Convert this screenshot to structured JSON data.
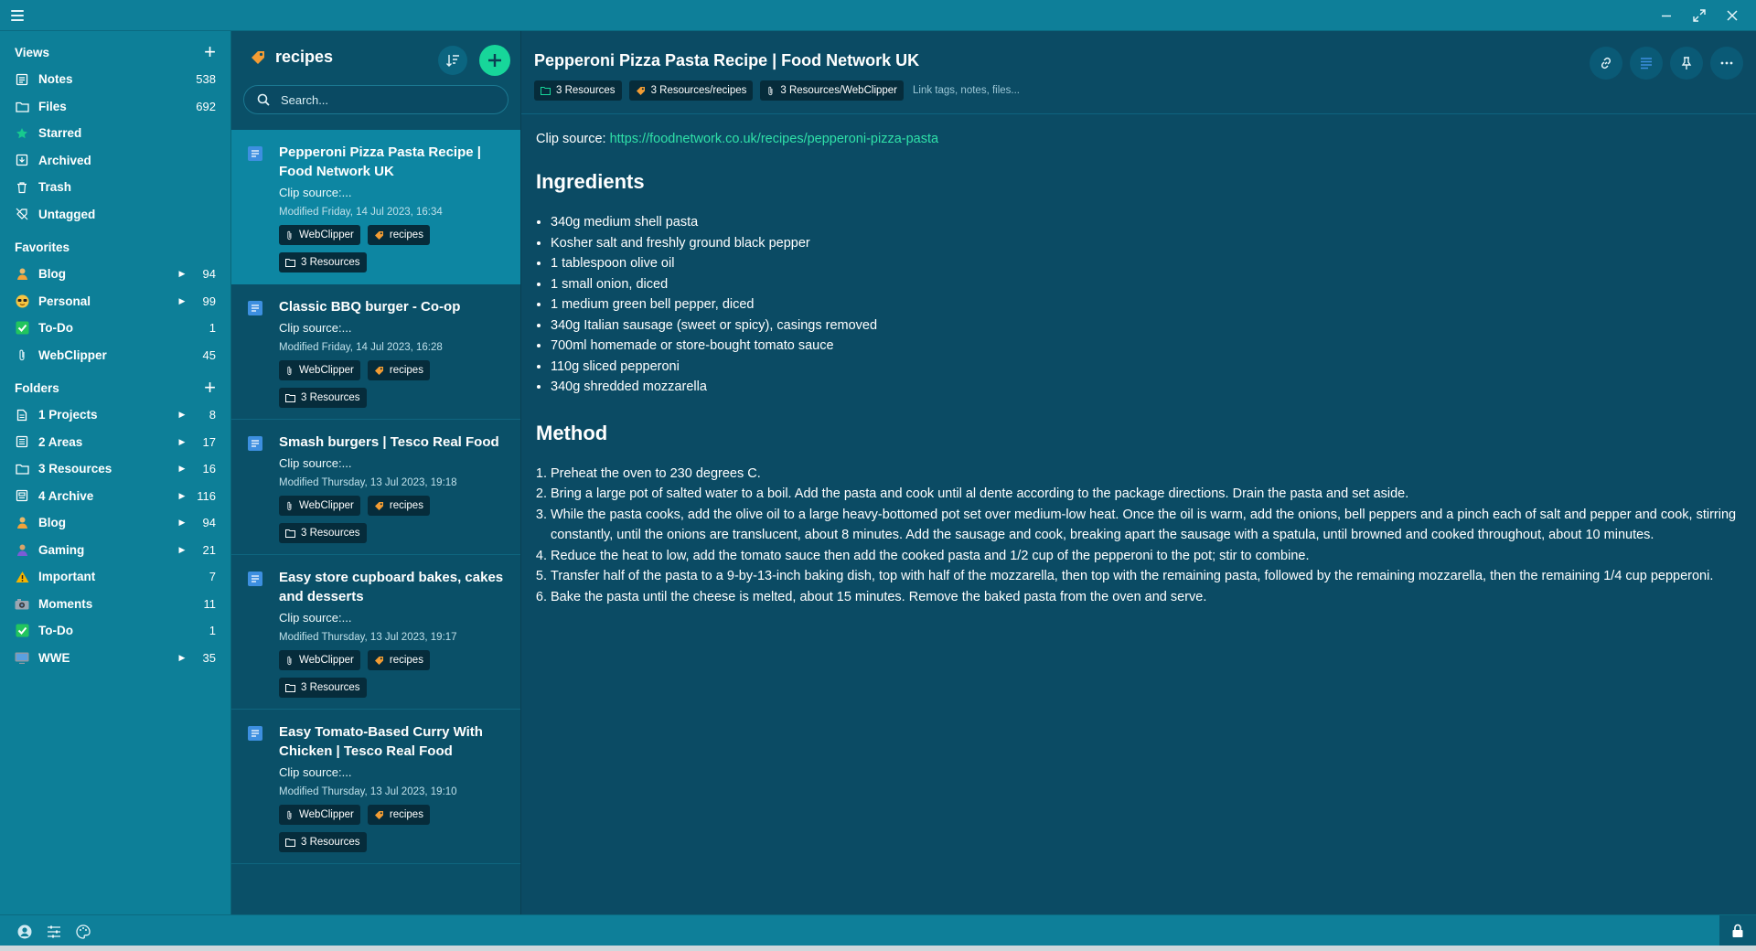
{
  "window": {
    "controls": [
      "minimize",
      "maximize",
      "close"
    ]
  },
  "sidebar": {
    "views_label": "Views",
    "views": [
      {
        "label": "Notes",
        "count": "538",
        "icon": "notes-icon"
      },
      {
        "label": "Files",
        "count": "692",
        "icon": "folder-icon"
      },
      {
        "label": "Starred",
        "count": "",
        "icon": "star-icon"
      },
      {
        "label": "Archived",
        "count": "",
        "icon": "archive-icon"
      },
      {
        "label": "Trash",
        "count": "",
        "icon": "trash-icon"
      },
      {
        "label": "Untagged",
        "count": "",
        "icon": "untagged-icon"
      }
    ],
    "favorites_label": "Favorites",
    "favorites": [
      {
        "label": "Blog",
        "count": "94",
        "icon": "blog-emoji-icon",
        "expandable": true
      },
      {
        "label": "Personal",
        "count": "99",
        "icon": "sunglasses-emoji-icon",
        "expandable": true
      },
      {
        "label": "To-Do",
        "count": "1",
        "icon": "checkmark-emoji-icon",
        "expandable": false
      },
      {
        "label": "WebClipper",
        "count": "45",
        "icon": "paperclip-icon",
        "expandable": false
      }
    ],
    "folders_label": "Folders",
    "folders": [
      {
        "label": "1 Projects",
        "count": "8",
        "icon": "document-icon",
        "expandable": true
      },
      {
        "label": "2 Areas",
        "count": "17",
        "icon": "list-icon",
        "expandable": true
      },
      {
        "label": "3 Resources",
        "count": "16",
        "icon": "folder-icon",
        "expandable": true
      },
      {
        "label": "4 Archive",
        "count": "116",
        "icon": "archive-box-icon",
        "expandable": true
      },
      {
        "label": "Blog",
        "count": "94",
        "icon": "blog-emoji-icon",
        "expandable": true
      },
      {
        "label": "Gaming",
        "count": "21",
        "icon": "gamepad-emoji-icon",
        "expandable": true
      },
      {
        "label": "Important",
        "count": "7",
        "icon": "warning-emoji-icon",
        "expandable": false
      },
      {
        "label": "Moments",
        "count": "11",
        "icon": "camera-emoji-icon",
        "expandable": false
      },
      {
        "label": "To-Do",
        "count": "1",
        "icon": "checkmark-emoji-icon",
        "expandable": false
      },
      {
        "label": "WWE",
        "count": "35",
        "icon": "tv-emoji-icon",
        "expandable": true
      }
    ]
  },
  "notelist": {
    "title": "recipes",
    "search_placeholder": "Search...",
    "notes": [
      {
        "title": "Pepperoni Pizza Pasta Recipe | Food Network UK",
        "snippet": "Clip source:...",
        "modified": "Modified Friday, 14 Jul 2023, 16:34",
        "tags": [
          "WebClipper",
          "recipes"
        ],
        "folder": "3 Resources",
        "active": true
      },
      {
        "title": "Classic BBQ burger - Co-op",
        "snippet": "Clip source:...",
        "modified": "Modified Friday, 14 Jul 2023, 16:28",
        "tags": [
          "WebClipper",
          "recipes"
        ],
        "folder": "3 Resources",
        "active": false
      },
      {
        "title": "Smash burgers | Tesco Real Food",
        "snippet": "Clip source:...",
        "modified": "Modified Thursday, 13 Jul 2023, 19:18",
        "tags": [
          "WebClipper",
          "recipes"
        ],
        "folder": "3 Resources",
        "active": false
      },
      {
        "title": "Easy store cupboard bakes, cakes and desserts",
        "snippet": "Clip source:...",
        "modified": "Modified Thursday, 13 Jul 2023, 19:17",
        "tags": [
          "WebClipper",
          "recipes"
        ],
        "folder": "3 Resources",
        "active": false
      },
      {
        "title": "Easy Tomato-Based Curry With Chicken | Tesco Real Food",
        "snippet": "Clip source:...",
        "modified": "Modified Thursday, 13 Jul 2023, 19:10",
        "tags": [
          "WebClipper",
          "recipes"
        ],
        "folder": "3 Resources",
        "active": false
      }
    ]
  },
  "editor": {
    "title": "Pepperoni Pizza Pasta Recipe | Food Network UK",
    "chips": [
      "3 Resources",
      "3 Resources/recipes",
      "3 Resources/WebClipper"
    ],
    "link_hint": "Link tags, notes, files...",
    "clip_label": "Clip source: ",
    "clip_url": "https://foodnetwork.co.uk/recipes/pepperoni-pizza-pasta",
    "ingredients_heading": "Ingredients",
    "ingredients": [
      "340g medium shell pasta",
      "Kosher salt and freshly ground black pepper",
      "1 tablespoon olive oil",
      "1 small onion, diced",
      "1 medium green bell pepper, diced",
      "340g Italian sausage (sweet or spicy), casings removed",
      "700ml homemade or store-bought tomato sauce",
      "110g sliced pepperoni",
      "340g shredded mozzarella"
    ],
    "method_heading": "Method",
    "method": [
      "Preheat the oven to 230 degrees C.",
      "Bring a large pot of salted water to a boil. Add the pasta and cook until al dente according to the package directions. Drain the pasta and set aside.",
      "While the pasta cooks, add the olive oil to a large heavy-bottomed pot set over medium-low heat. Once the oil is warm, add the onions, bell peppers and a pinch each of salt and pepper and cook, stirring constantly, until the onions are translucent, about 8 minutes. Add the sausage and cook, breaking apart the sausage with a spatula, until browned and cooked throughout, about 10 minutes.",
      "Reduce the heat to low, add the tomato sauce then add the cooked pasta and 1/2 cup of the pepperoni to the pot; stir to combine.",
      "Transfer half of the pasta to a 9-by-13-inch baking dish, top with half of the mozzarella, then top with the remaining pasta, followed by the remaining mozzarella, then the remaining 1/4 cup pepperoni.",
      "Bake the pasta until the cheese is melted, about 15 minutes. Remove the baked pasta from the oven and serve."
    ]
  },
  "colors": {
    "accent": "#17d69a",
    "link": "#2fe0a8",
    "sidebar_bg": "#0d7f98",
    "list_bg": "#0a5068",
    "editor_bg": "#0b4b64",
    "chip_bg": "#062c3b",
    "active_card": "#0d86a2"
  }
}
